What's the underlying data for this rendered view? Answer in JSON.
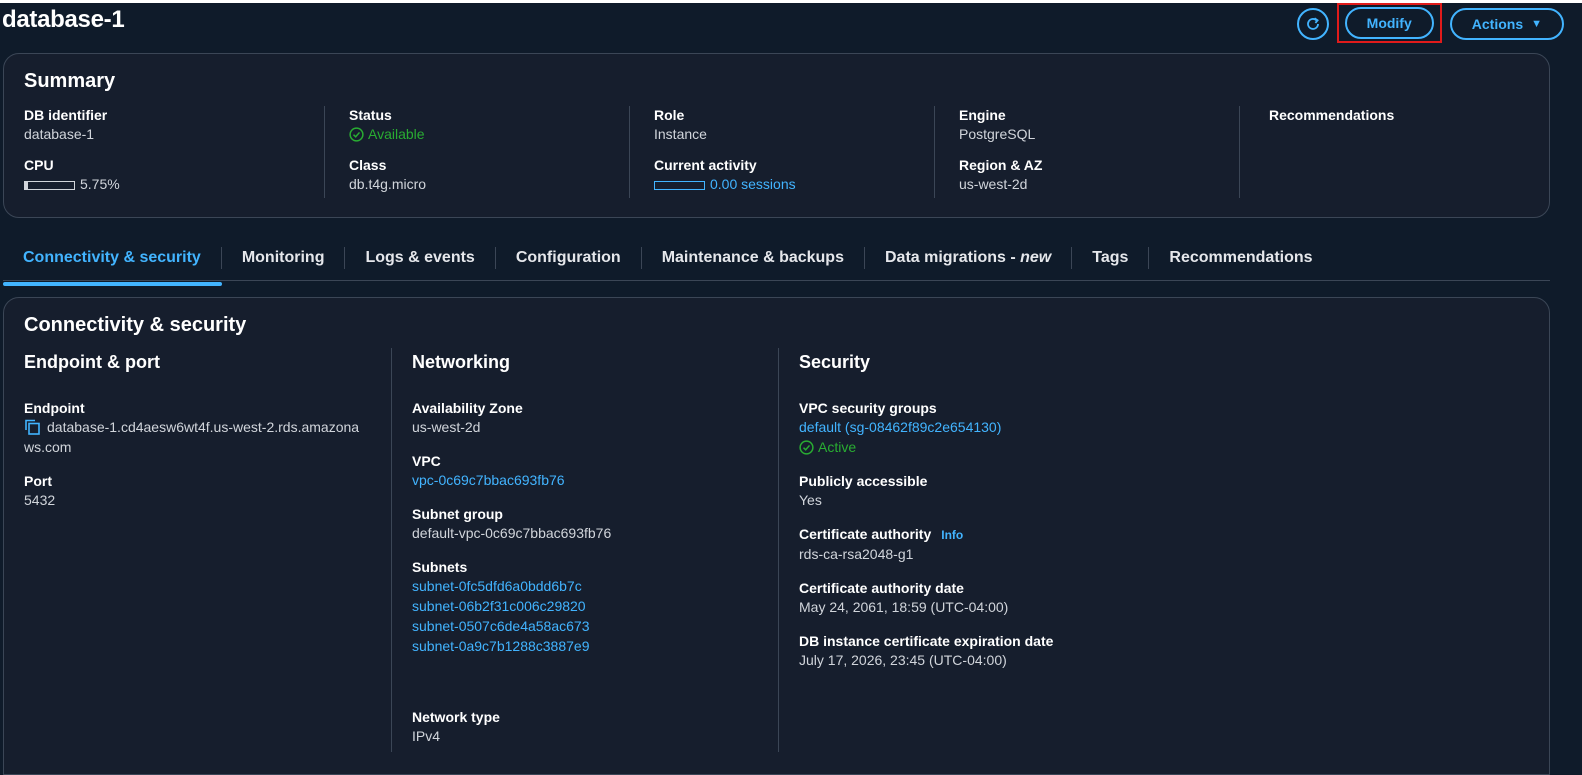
{
  "page_title": "database-1",
  "header": {
    "modify_label": "Modify",
    "actions_label": "Actions"
  },
  "summary": {
    "title": "Summary",
    "db_identifier": {
      "label": "DB identifier",
      "value": "database-1"
    },
    "cpu": {
      "label": "CPU",
      "value": "5.75%",
      "fraction": 0.0575
    },
    "status": {
      "label": "Status",
      "value": "Available"
    },
    "class": {
      "label": "Class",
      "value": "db.t4g.micro"
    },
    "role": {
      "label": "Role",
      "value": "Instance"
    },
    "current_activity": {
      "label": "Current activity",
      "value": "0.00 sessions",
      "fraction": 0
    },
    "engine": {
      "label": "Engine",
      "value": "PostgreSQL"
    },
    "region": {
      "label": "Region & AZ",
      "value": "us-west-2d"
    },
    "recommendations": {
      "label": "Recommendations"
    }
  },
  "tabs": [
    {
      "label": "Connectivity & security"
    },
    {
      "label": "Monitoring"
    },
    {
      "label": "Logs & events"
    },
    {
      "label": "Configuration"
    },
    {
      "label": "Maintenance & backups"
    },
    {
      "label": "Data migrations - ",
      "suffix": "new"
    },
    {
      "label": "Tags"
    },
    {
      "label": "Recommendations"
    }
  ],
  "connectivity": {
    "title": "Connectivity & security",
    "endpoint_port": {
      "title": "Endpoint & port",
      "endpoint_label": "Endpoint",
      "endpoint_line1": "database-1.cd4aesw6wt4f.us-west-2.rds.amazona",
      "endpoint_line2": "ws.com",
      "port_label": "Port",
      "port_value": "5432"
    },
    "networking": {
      "title": "Networking",
      "az_label": "Availability Zone",
      "az_value": "us-west-2d",
      "vpc_label": "VPC",
      "vpc_value": "vpc-0c69c7bbac693fb76",
      "subnet_group_label": "Subnet group",
      "subnet_group_value": "default-vpc-0c69c7bbac693fb76",
      "subnets_label": "Subnets",
      "subnets": [
        "subnet-0fc5dfd6a0bdd6b7c",
        "subnet-06b2f31c006c29820",
        "subnet-0507c6de4a58ac673",
        "subnet-0a9c7b1288c3887e9"
      ],
      "network_type_label": "Network type",
      "network_type_value": "IPv4"
    },
    "security": {
      "title": "Security",
      "vpc_sg_label": "VPC security groups",
      "vpc_sg_value": "default (sg-08462f89c2e654130)",
      "vpc_sg_status": "Active",
      "public_label": "Publicly accessible",
      "public_value": "Yes",
      "ca_label": "Certificate authority",
      "ca_info": "Info",
      "ca_value": "rds-ca-rsa2048-g1",
      "ca_date_label": "Certificate authority date",
      "ca_date_value": "May 24, 2061, 18:59 (UTC-04:00)",
      "cert_exp_label": "DB instance certificate expiration date",
      "cert_exp_value": "July 17, 2026, 23:45 (UTC-04:00)"
    }
  },
  "colors": {
    "accent": "#42b4ff",
    "success": "#29ad32",
    "background": "#0f1b2a",
    "panel": "#161e2d",
    "highlight": "#e01b1b"
  }
}
